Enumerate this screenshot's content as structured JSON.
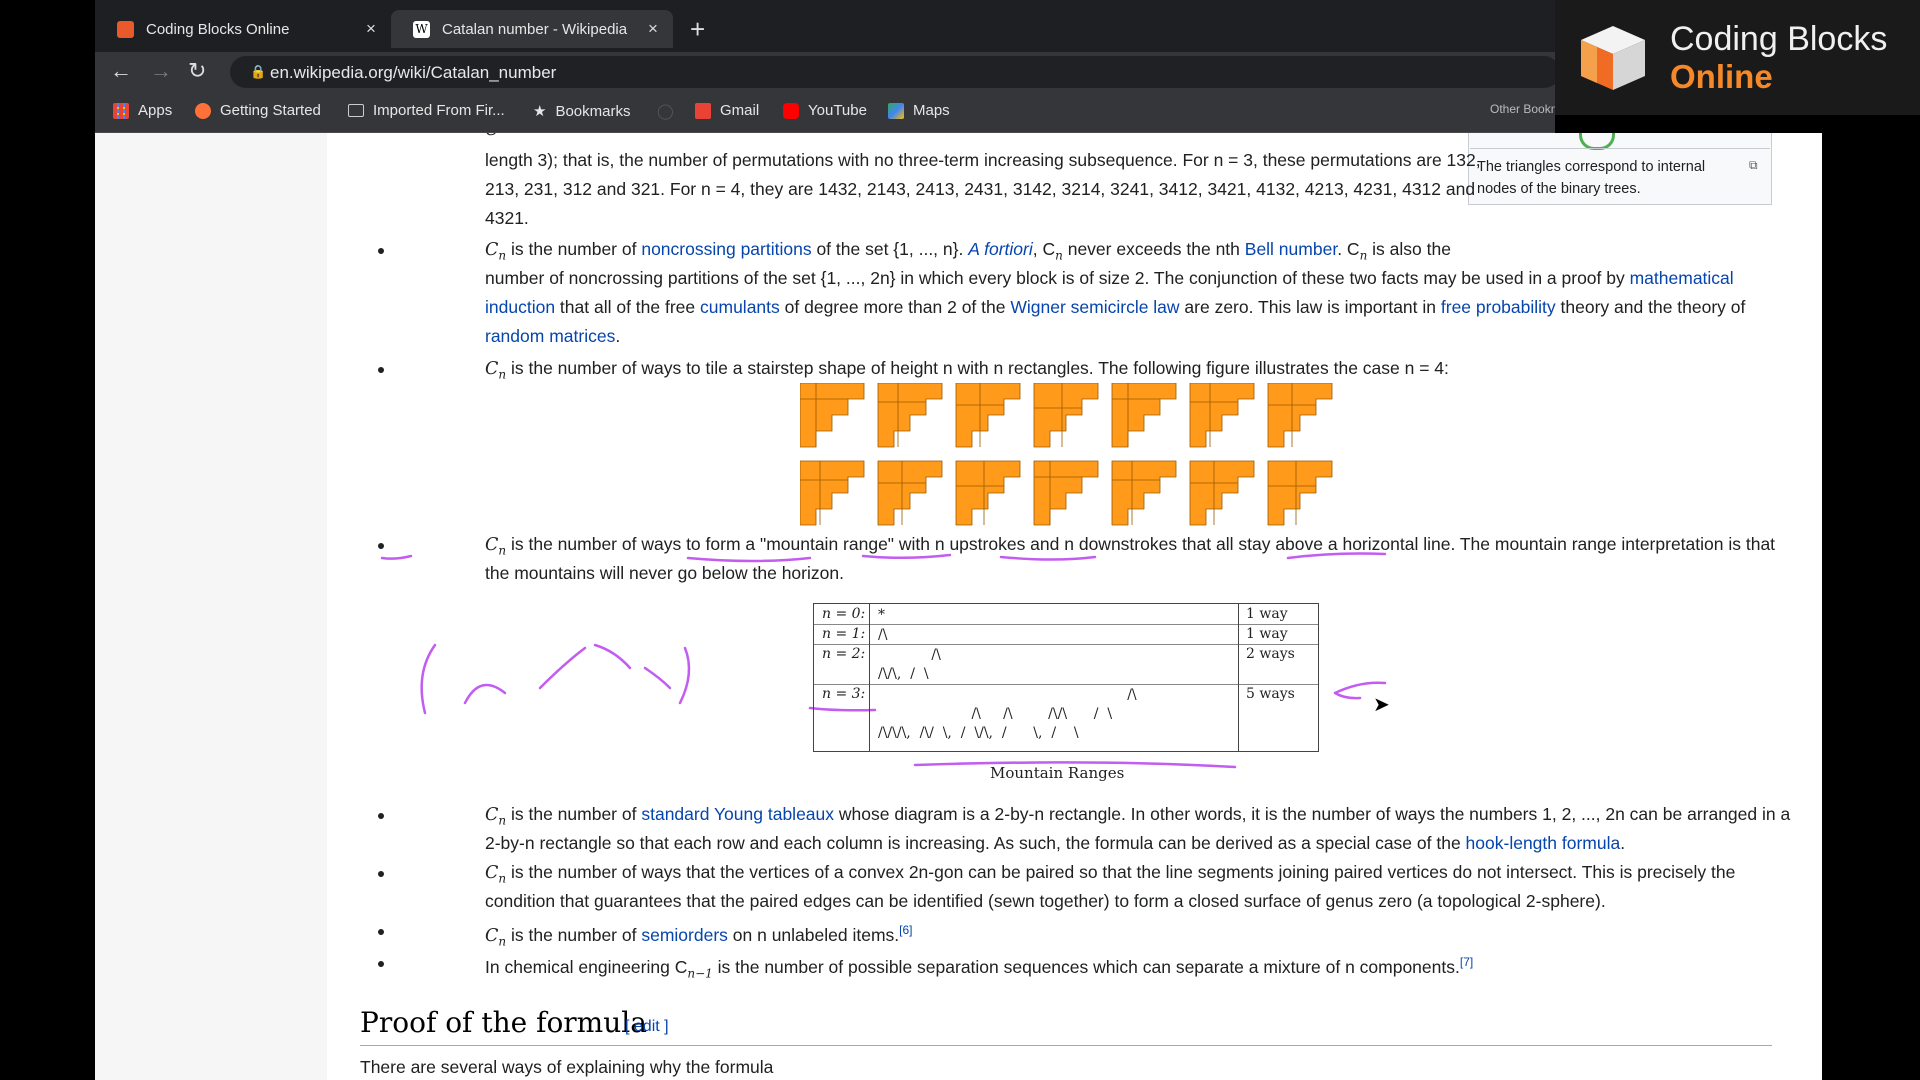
{
  "browser": {
    "tabs": [
      {
        "label": "Coding Blocks Online",
        "close": "×"
      },
      {
        "label": "Catalan number - Wikipedia",
        "close": "×"
      }
    ],
    "new_tab": "+",
    "url": "en.wikipedia.org/wiki/Catalan_number",
    "bookmarks": [
      "Apps",
      "Getting Started",
      "Imported From Fir...",
      "Bookmarks",
      "Gmail",
      "YouTube",
      "Maps"
    ],
    "other_bookmarks": "Other Bookmarks"
  },
  "overlay": {
    "line1": "Coding Blocks",
    "line2": "Online"
  },
  "infobox": {
    "caption": "The triangles correspond to internal nodes of the binary trees."
  },
  "article": {
    "perm_line1": "C",
    "perm_line2": "length 3); that is, the number of permutations with no three-term increasing subsequence. For n = 3, these permutations are 132,",
    "perm_line3": "213, 231, 312 and 321. For n = 4, they are 1432, 2143, 2413, 2431, 3142, 3214, 3241, 3412, 3421, 4132, 4213, 4231, 4312 and",
    "perm_line4": "4321.",
    "nc_line1_a": " is the number of ",
    "nc_link1": "noncrossing partitions",
    "nc_line1_b": " of the set {1, ..., n}. ",
    "nc_link2": "A fortiori",
    "nc_line1_c": ", C",
    "nc_line1_d": " never exceeds the nth ",
    "nc_link3": "Bell number",
    "nc_line1_e": ". C",
    "nc_line1_f": " is also the",
    "nc_line2_a": "number of noncrossing partitions of the set {1, ..., 2n} in which every block is of size 2. The conjunction of these two facts may be used in a proof by ",
    "nc_link4": "mathematical",
    "nc_link5": "induction",
    "nc_line3_a": " that all of the free ",
    "nc_link6": "cumulants",
    "nc_line3_b": " of degree more than 2 of the ",
    "nc_link7": "Wigner semicircle law",
    "nc_line3_c": " are zero. This law is important in ",
    "nc_link8": "free probability",
    "nc_line3_d": " theory and the theory of",
    "nc_link9": "random matrices",
    "nc_line4_end": ".",
    "stair_text": " is the number of ways to tile a stairstep shape of height n with n rectangles. The following figure illustrates the case n = 4:",
    "mountain_line1": " is the number of ways to form a \"mountain range\" with n upstrokes and n downstrokes that all stay above a horizontal line. The mountain range interpretation is that",
    "mountain_line2": "the mountains will never go below the horizon.",
    "table": [
      {
        "n": "n = 0:",
        "pic": "*",
        "ways": "1 way"
      },
      {
        "n": "n = 1:",
        "pic": "/\\",
        "ways": "1 way"
      },
      {
        "n": "n = 2:",
        "pic": "            /\\\n/\\/\\,  /  \\",
        "ways": "2 ways"
      },
      {
        "n": "n = 3:",
        "pic": "                                                        /\\\n                     /\\     /\\        /\\/\\      /  \\\n/\\/\\/\\,  /\\/  \\,  /  \\/\\,  /      \\,  /    \\",
        "ways": "5 ways"
      }
    ],
    "table_caption": "Mountain Ranges",
    "young_line1_a": " is the number of ",
    "young_link": "standard Young tableaux",
    "young_line1_b": " whose diagram is a 2-by-n rectangle. In other words, it is the number of ways the numbers 1, 2, ..., 2n can be arranged in a",
    "young_line2_a": "2-by-n rectangle so that each row and each column is increasing. As such, the formula can be derived as a special case of the ",
    "young_link2": "hook-length formula",
    "young_line2_b": ".",
    "polygon_line1": " is the number of ways that the vertices of a convex 2n-gon can be paired so that the line segments joining paired vertices do not intersect. This is precisely the",
    "polygon_line2": "condition that guarantees that the paired edges can be identified (sewn together) to form a closed surface of genus zero (a topological 2-sphere).",
    "semi_a": " is the number of ",
    "semi_link": "semiorders",
    "semi_b": " on n unlabeled items.",
    "semi_ref": "[6]",
    "chem_a": "In chemical engineering C",
    "chem_sub": "n−1",
    "chem_b": " is the number of possible separation sequences which can separate a mixture of n components.",
    "chem_ref": "[7]",
    "cn_sub": "n",
    "heading": "Proof of the formula",
    "edit": "[ edit ]",
    "proof_line": "There are several ways of explaining why the formula"
  },
  "colors": {
    "tile_orange": "#ff9a1a",
    "annotation": "#c35cf0",
    "link": "#0645ad"
  }
}
